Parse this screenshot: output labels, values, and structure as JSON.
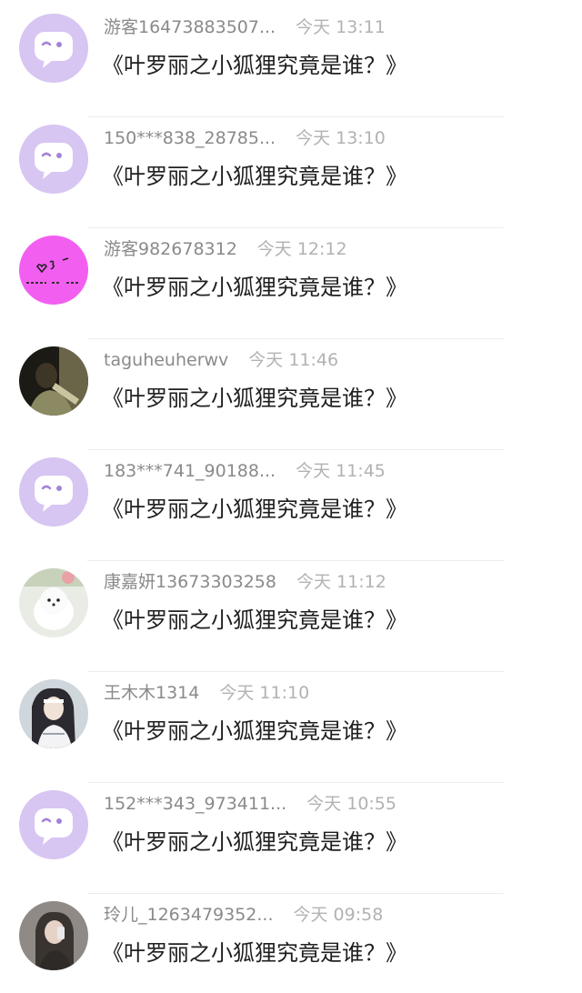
{
  "comments": [
    {
      "username": "游客16473883507...",
      "time": "今天 13:11",
      "message": "《叶罗丽之小狐狸究竟是谁？》",
      "avatar": "default-chat-icon"
    },
    {
      "username": "150***838_28785...",
      "time": "今天 13:10",
      "message": "《叶罗丽之小狐狸究竟是谁？》",
      "avatar": "default-chat-icon"
    },
    {
      "username": "游客982678312",
      "time": "今天 12:12",
      "message": "《叶罗丽之小狐狸究竟是谁？》",
      "avatar": "pink-doodle-avatar"
    },
    {
      "username": "taguheuherwv",
      "time": "今天 11:46",
      "message": "《叶罗丽之小狐狸究竟是谁？》",
      "avatar": "photo-avatar"
    },
    {
      "username": "183***741_90188...",
      "time": "今天 11:45",
      "message": "《叶罗丽之小狐狸究竟是谁？》",
      "avatar": "default-chat-icon"
    },
    {
      "username": "康嘉妍13673303258",
      "time": "今天 11:12",
      "message": "《叶罗丽之小狐狸究竟是谁？》",
      "avatar": "white-dog-avatar"
    },
    {
      "username": "王木木1314",
      "time": "今天 11:10",
      "message": "《叶罗丽之小狐狸究竟是谁？》",
      "avatar": "anime-character-avatar"
    },
    {
      "username": "152***343_973411...",
      "time": "今天 10:55",
      "message": "《叶罗丽之小狐狸究竟是谁？》",
      "avatar": "default-chat-icon"
    },
    {
      "username": "玲儿_1263479352...",
      "time": "今天 09:58",
      "message": "《叶罗丽之小狐狸究竟是谁？》",
      "avatar": "photo-avatar"
    }
  ],
  "colors": {
    "default_avatar_bg": "#d7c5f2",
    "default_avatar_accent": "#a383d8",
    "username": "#8a8a8a",
    "time": "#b2b2b2",
    "message": "#1f1f1f",
    "divider": "#ececec"
  }
}
